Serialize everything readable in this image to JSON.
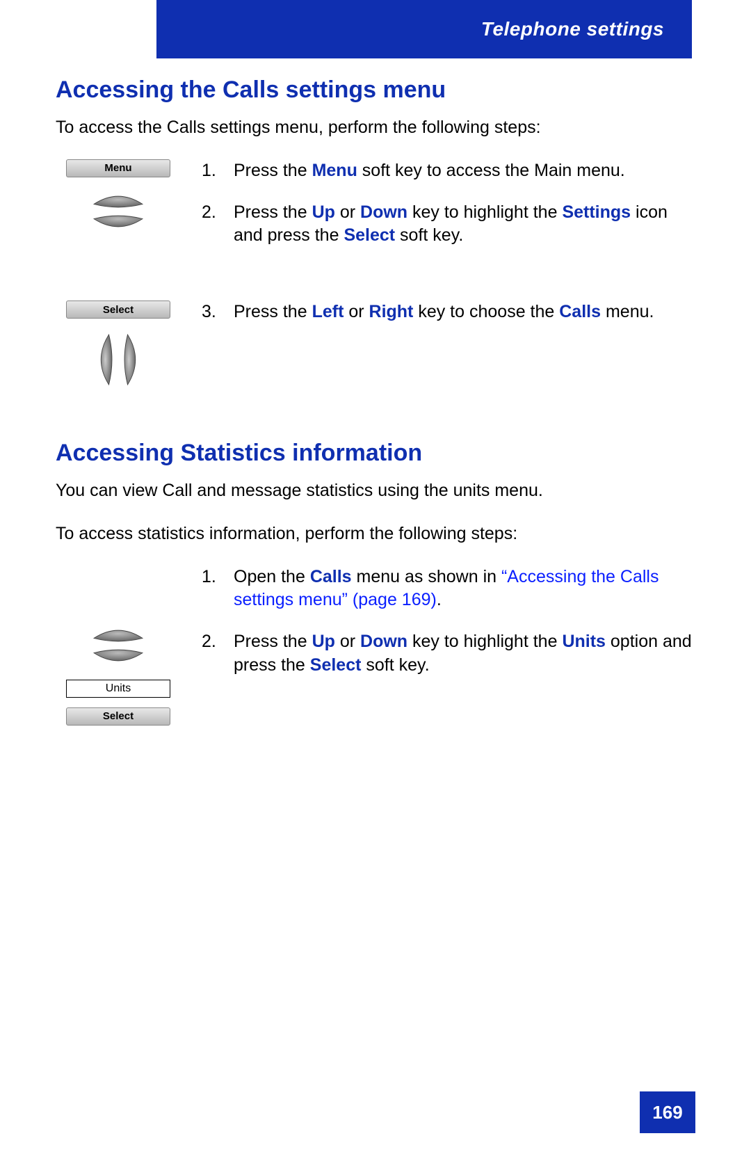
{
  "header": {
    "title": "Telephone settings"
  },
  "section1": {
    "heading": "Accessing the Calls settings menu",
    "intro": "To access the Calls settings menu, perform the following steps:",
    "softkey1": "Menu",
    "softkey2": "Select",
    "step1_a": "Press the ",
    "step1_kw1": "Menu",
    "step1_b": " soft key to access the Main menu.",
    "step2_a": "Press the ",
    "step2_kw1": "Up",
    "step2_b": " or ",
    "step2_kw2": "Down",
    "step2_c": " key to highlight the ",
    "step2_kw3": "Settings",
    "step2_d": " icon and press the ",
    "step2_kw4": "Select",
    "step2_e": " soft key.",
    "step3_a": "Press the ",
    "step3_kw1": "Left",
    "step3_b": " or ",
    "step3_kw2": "Right",
    "step3_c": " key to choose the ",
    "step3_kw3": "Calls",
    "step3_d": " menu."
  },
  "section2": {
    "heading": "Accessing Statistics information",
    "intro1": "You can view Call and message statistics using the units menu.",
    "intro2": "To access statistics information, perform the following steps:",
    "selectbox": "Units",
    "softkey": "Select",
    "step1_a": "Open the ",
    "step1_kw1": "Calls",
    "step1_b": " menu as shown in ",
    "step1_link": "“Accessing the Calls settings menu” (page 169)",
    "step1_c": ".",
    "step2_a": "Press the ",
    "step2_kw1": "Up",
    "step2_b": " or ",
    "step2_kw2": "Down",
    "step2_c": " key to highlight the ",
    "step2_kw3": "Units",
    "step2_d": " option and press the ",
    "step2_kw4": "Select",
    "step2_e": " soft key."
  },
  "page_number": "169"
}
